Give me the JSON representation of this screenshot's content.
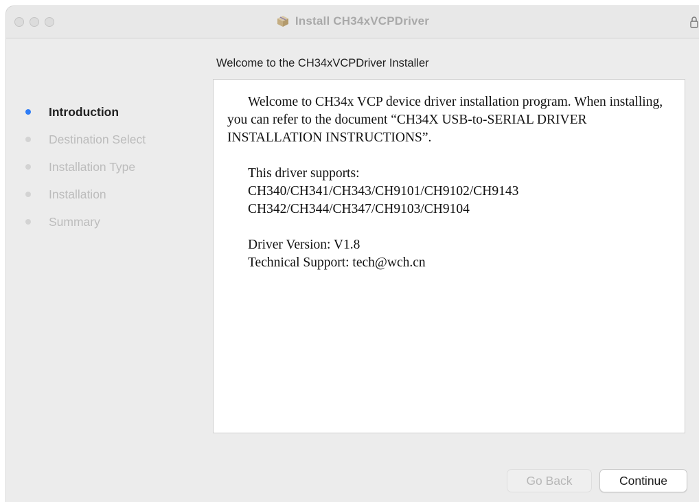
{
  "window": {
    "title": "Install CH34xVCPDriver"
  },
  "heading": "Welcome to the CH34xVCPDriver Installer",
  "steps": [
    {
      "label": "Introduction",
      "state": "active"
    },
    {
      "label": "Destination Select",
      "state": "inactive"
    },
    {
      "label": "Installation Type",
      "state": "inactive"
    },
    {
      "label": "Installation",
      "state": "inactive"
    },
    {
      "label": "Summary",
      "state": "inactive"
    }
  ],
  "content": {
    "intro": "Welcome to CH34x VCP device driver installation program. When installing, you can refer to the document  “CH34X USB-to-SERIAL DRIVER INSTALLATION INSTRUCTIONS”.",
    "supports_label": "This driver supports:",
    "supports_line1": "CH340/CH341/CH343/CH9101/CH9102/CH9143",
    "supports_line2": "CH342/CH344/CH347/CH9103/CH9104",
    "version": "Driver Version: V1.8",
    "support": "Technical Support: tech@wch.cn"
  },
  "buttons": {
    "back": "Go Back",
    "continue": "Continue"
  },
  "icons": {
    "window_icon": "package-installer-icon",
    "lock": "lock-icon"
  },
  "colors": {
    "accent": "#2f7df6",
    "inactive_text": "#bcbcbc"
  }
}
